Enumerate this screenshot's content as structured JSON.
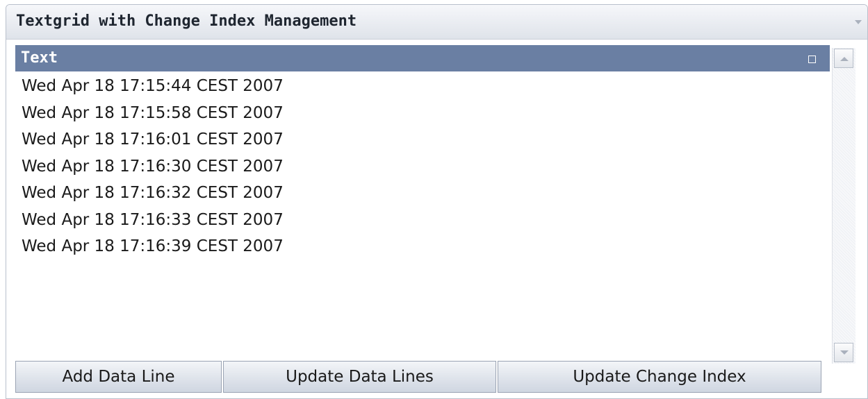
{
  "panel": {
    "title": "Textgrid with Change Index Management"
  },
  "grid": {
    "column_header": "Text",
    "rows": [
      "Wed Apr 18 17:15:44 CEST 2007",
      "Wed Apr 18 17:15:58 CEST 2007",
      "Wed Apr 18 17:16:01 CEST 2007",
      "Wed Apr 18 17:16:30 CEST 2007",
      "Wed Apr 18 17:16:32 CEST 2007",
      "Wed Apr 18 17:16:33 CEST 2007",
      "Wed Apr 18 17:16:39 CEST 2007"
    ]
  },
  "buttons": {
    "add_data_line": "Add Data Line",
    "update_data_lines": "Update Data Lines",
    "update_change_index": "Update Change Index"
  },
  "colors": {
    "header_bg": "#6a7fa3",
    "panel_border": "#b9c0cc"
  },
  "icons": {
    "collapse": "triangle-down-icon",
    "column_resize": "square-icon",
    "scroll_up": "arrow-up-icon",
    "scroll_down": "arrow-down-icon"
  }
}
